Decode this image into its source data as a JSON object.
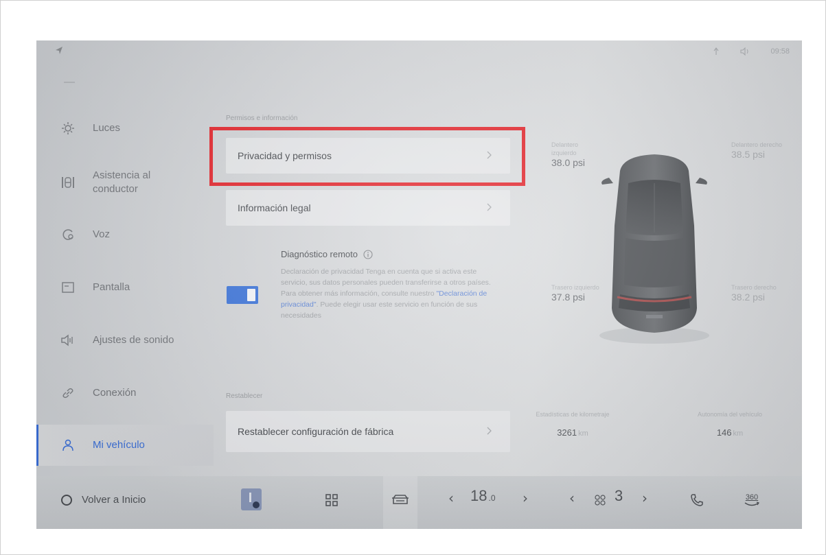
{
  "status_bar": {
    "time": "09:58"
  },
  "sidebar": {
    "items": [
      {
        "label": "Luces",
        "icon": "sun-icon"
      },
      {
        "label": "Asistencia al\nconductor",
        "icon": "steering-wheel-icon"
      },
      {
        "label": "Voz",
        "icon": "voice-icon"
      },
      {
        "label": "Pantalla",
        "icon": "display-icon"
      },
      {
        "label": "Ajustes de sonido",
        "icon": "speaker-icon"
      },
      {
        "label": "Conexión",
        "icon": "link-icon"
      },
      {
        "label": "Mi vehículo",
        "icon": "person-icon",
        "active": true
      }
    ]
  },
  "main": {
    "permissions_section_title": "Permisos e información",
    "privacy_row_label": "Privacidad y permisos",
    "legal_row_label": "Información legal",
    "remote_diagnostics": {
      "title": "Diagnóstico remoto",
      "enabled": true,
      "desc_before_link": "Declaración de privacidad Tenga en cuenta que si activa este servicio, sus datos personales pueden transferirse a otros países. Para obtener más información, consulte nuestro ",
      "link_text": "\"Declaración de privacidad\"",
      "desc_after_link": ". Puede elegir usar este servicio en función de sus necesidades"
    },
    "reset_section_title": "Restablecer",
    "factory_reset_label": "Restablecer configuración de fábrica"
  },
  "vehicle": {
    "tires": {
      "front_left": {
        "label": "Delantero izquierdo",
        "value": "38.0 psi"
      },
      "front_right": {
        "label": "Delantero derecho",
        "value": "38.5 psi"
      },
      "rear_left": {
        "label": "Trasero izquierdo",
        "value": "37.8 psi"
      },
      "rear_right": {
        "label": "Trasero derecho",
        "value": "38.2 psi"
      }
    },
    "mileage_label": "Estadísticas de kilometraje",
    "mileage_value": "3261",
    "mileage_unit": "km",
    "range_label": "Autonomía del vehículo",
    "range_value": "146",
    "range_unit": "km"
  },
  "dock": {
    "home_label": "Volver a Inicio",
    "temperature_whole": "18",
    "temperature_decimal": ".0",
    "fan_level": "3",
    "camera_label": "360"
  },
  "colors": {
    "accent": "#3a6fd8",
    "highlight": "#e3242b"
  }
}
